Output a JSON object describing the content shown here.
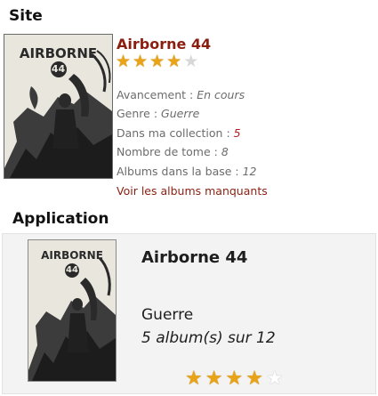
{
  "sections": {
    "site_title": "Site",
    "app_title": "Application"
  },
  "cover": {
    "series_title": "AIRBORNE",
    "series_number": "44"
  },
  "site": {
    "name": "Airborne 44",
    "rating": 4,
    "rating_max": 5,
    "fields": [
      {
        "label": "Avancement : ",
        "value": "En cours"
      },
      {
        "label": "Genre : ",
        "value": "Guerre"
      },
      {
        "label": "Dans ma collection : ",
        "value": "5"
      },
      {
        "label": "Nombre de tome : ",
        "value": "8"
      },
      {
        "label": "Albums dans la base : ",
        "value": "12"
      }
    ],
    "link": "Voir les albums manquants"
  },
  "app": {
    "name": "Airborne 44",
    "genre": "Guerre",
    "albums": "5 album(s) sur 12",
    "rating": 4,
    "rating_max": 5
  },
  "colors": {
    "accent": "#8a1f11",
    "star": "#e8a317",
    "collection": "#b51f1f"
  }
}
